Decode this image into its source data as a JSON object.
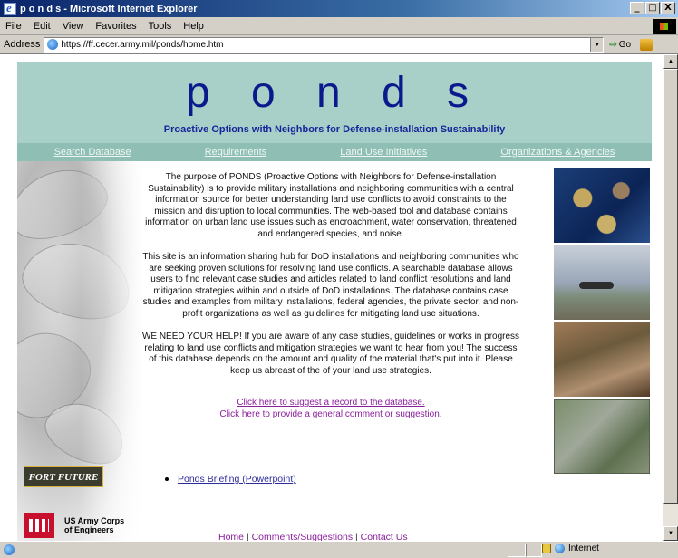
{
  "window": {
    "title": "p o n d s - Microsoft Internet Explorer",
    "controls": [
      "_",
      "□",
      "X"
    ]
  },
  "menu": [
    "File",
    "Edit",
    "View",
    "Favorites",
    "Tools",
    "Help"
  ],
  "address": {
    "label": "Address",
    "url": "https://ff.cecer.army.mil/ponds/home.htm",
    "go": "Go"
  },
  "site": {
    "logo": "p o n d s",
    "tagline": "Proactive Options with Neighbors for Defense-installation Sustainability",
    "nav": [
      "Search Database",
      "Requirements",
      "Land Use Initiatives",
      "Organizations & Agencies"
    ],
    "paragraphs": [
      "The purpose of PONDS (Proactive Options with Neighbors for Defense-installation Sustainability) is to provide military installations and neighboring communities with a central information source for better understanding land use conflicts to avoid constraints to the mission and disruption to local communities. The web-based tool and database contains information on urban land use issues such as encroachment, water conservation, threatened and endangered species, and noise.",
      "This site is an information sharing hub for DoD installations and neighboring communities who are seeking proven solutions for resolving land use conflicts. A searchable database allows users to find relevant case studies and articles related to land conflict resolutions and land mitigation strategies within and outside of DoD installations. The database contains case studies and examples from military installations, federal agencies, the private sector, and non-profit organizations as well as guidelines for mitigating land use situations.",
      "WE NEED YOUR HELP! If you are aware of any case studies, guidelines or works in progress relating to land use conflicts and mitigation strategies we want to hear from you! The success of this database depends on the amount and quality of the material that's put into it. Please keep us abreast of the of your land use strategies."
    ],
    "links": [
      "Click here to suggest a record to the database.",
      "Click here to provide a general comment or suggestion."
    ],
    "briefing": "Ponds Briefing (Powerpoint)",
    "fort_future": "FORT FUTURE",
    "usace": [
      "US Army Corps",
      "of Engineers"
    ],
    "footer": [
      "Home",
      "Comments/Suggestions",
      "Contact Us"
    ],
    "footer_sep": "|"
  },
  "status": {
    "zone": "Internet"
  }
}
